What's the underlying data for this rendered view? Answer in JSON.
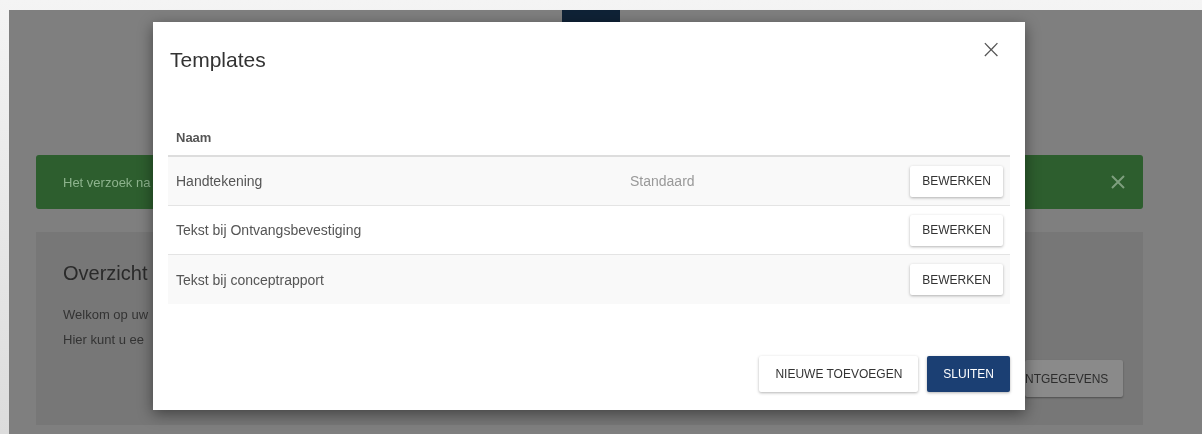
{
  "background": {
    "alert": {
      "text": "Het verzoek na"
    },
    "card": {
      "title": "Overzicht",
      "lines": [
        "Welkom op uw",
        "Hier kunt u ee"
      ],
      "button": "NTGEGEVENS"
    }
  },
  "dialog": {
    "title": "Templates",
    "close": "×",
    "table": {
      "columns": [
        "Naam"
      ],
      "rows": [
        {
          "name": "Handtekening",
          "status": "Standaard",
          "action": "BEWERKEN"
        },
        {
          "name": "Tekst bij Ontvangsbevestiging",
          "action": "BEWERKEN"
        },
        {
          "name": "Tekst bij conceptrapport",
          "action": "BEWERKEN"
        }
      ]
    },
    "buttons": [
      {
        "label": "NIEUWE TOEVOEGEN",
        "kind": "secondary"
      },
      {
        "label": "SLUITEN",
        "kind": "primary"
      }
    ]
  }
}
